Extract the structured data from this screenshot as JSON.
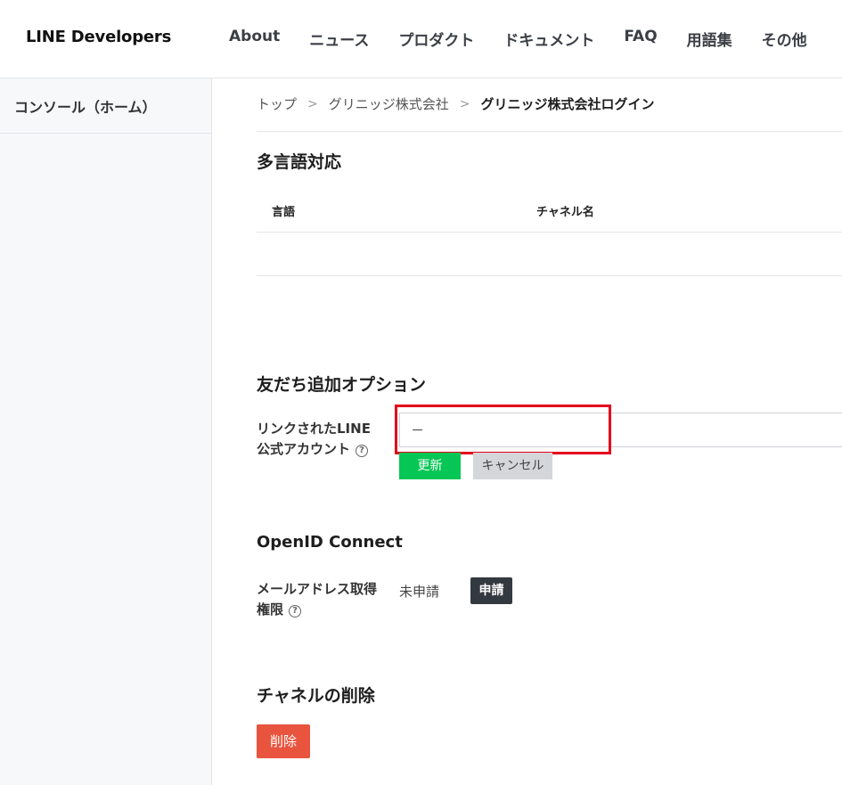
{
  "header": {
    "logo": "LINE Developers",
    "nav": [
      "About",
      "ニュース",
      "プロダクト",
      "ドキュメント",
      "FAQ",
      "用語集",
      "その他"
    ]
  },
  "sidebar": {
    "items": [
      {
        "label": "コンソール（ホーム）"
      }
    ]
  },
  "breadcrumb": {
    "items": [
      "トップ",
      "グリニッジ株式会社"
    ],
    "current": "グリニッジ株式会社ログイン",
    "separator": ">"
  },
  "multilang": {
    "title": "多言語対応",
    "columns": [
      "言語",
      "チャネル名"
    ]
  },
  "friend_option": {
    "title": "友だち追加オプション",
    "label_line1": "リンクされたLINE",
    "label_line2": "公式アカウント",
    "help_icon": "?",
    "input_value": "－",
    "update_label": "更新",
    "cancel_label": "キャンセル"
  },
  "openid": {
    "title": "OpenID Connect",
    "label_line1": "メールアドレス取得",
    "label_line2": "権限",
    "help_icon": "?",
    "status": "未申請",
    "apply_label": "申請"
  },
  "delete_channel": {
    "title": "チャネルの削除",
    "delete_label": "削除"
  },
  "colors": {
    "accent_green": "#06c755",
    "danger_red": "#e8543d",
    "highlight_red": "#e4001b",
    "dark_button": "#333940"
  }
}
